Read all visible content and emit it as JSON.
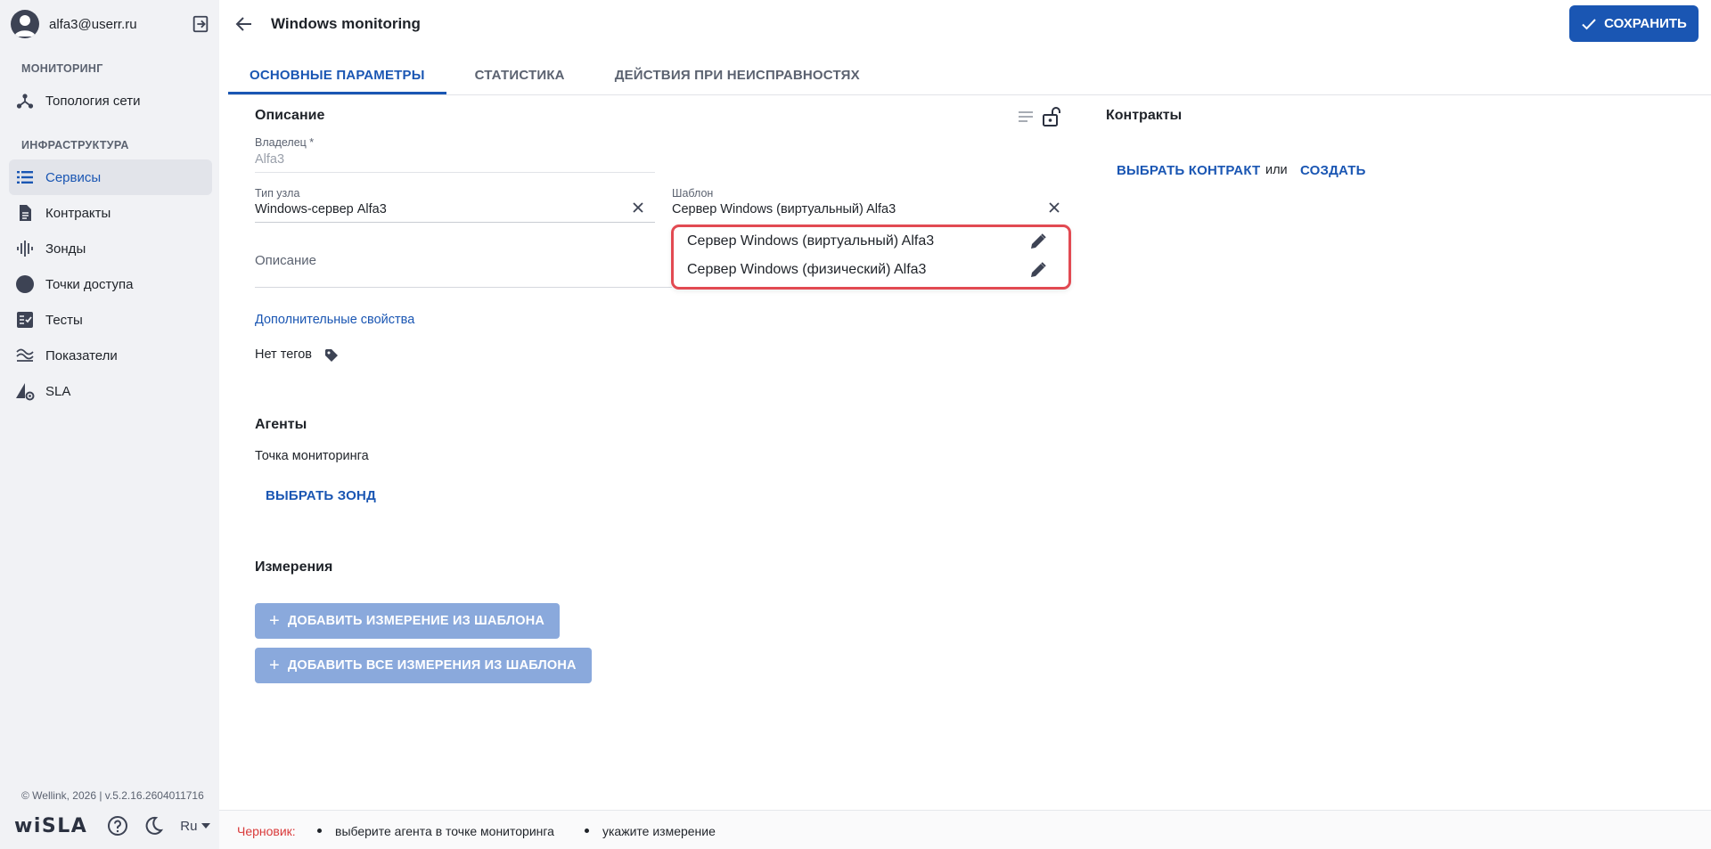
{
  "user": {
    "email": "alfa3@userr.ru"
  },
  "sidebar": {
    "sections": [
      {
        "title": "МОНИТОРИНГ"
      },
      {
        "title": "ИНФРАСТРУКТУРА"
      }
    ],
    "items": [
      {
        "label": "Топология сети",
        "icon": "topology-icon"
      },
      {
        "label": "Сервисы",
        "icon": "list-icon",
        "active": true
      },
      {
        "label": "Контракты",
        "icon": "document-icon"
      },
      {
        "label": "Зонды",
        "icon": "probe-icon"
      },
      {
        "label": "Точки доступа",
        "icon": "circle-icon"
      },
      {
        "label": "Тесты",
        "icon": "checklist-icon"
      },
      {
        "label": "Показатели",
        "icon": "waves-icon"
      },
      {
        "label": "SLA",
        "icon": "sla-settings-icon"
      }
    ],
    "copyright": "© Wellink, 2026 | v.5.2.16.2604011716",
    "logo": "wiSLA",
    "language": "Ru"
  },
  "header": {
    "title": "Windows monitoring",
    "save_label": "СОХРАНИТЬ"
  },
  "tabs": [
    {
      "label": "ОСНОВНЫЕ ПАРАМЕТРЫ",
      "active": true
    },
    {
      "label": "СТАТИСТИКА"
    },
    {
      "label": "ДЕЙСТВИЯ ПРИ НЕИСПРАВНОСТЯХ"
    }
  ],
  "description_section": {
    "title": "Описание",
    "owner_label": "Владелец *",
    "owner_value": "Alfa3",
    "node_type_label": "Тип узла",
    "node_type_value": "Windows-сервер Alfa3",
    "template_label": "Шаблон",
    "template_value": "Сервер Windows (виртуальный) Alfa3",
    "description_placeholder": "Описание",
    "extra_props_link": "Дополнительные свойства",
    "no_tags": "Нет тегов"
  },
  "template_dropdown": {
    "options": [
      "Сервер Windows (виртуальный) Alfa3",
      "Сервер Windows (физический) Alfa3"
    ]
  },
  "contracts": {
    "title": "Контракты",
    "select_label": "ВЫБРАТЬ КОНТРАКТ",
    "or_label": "или",
    "create_label": "СОЗДАТЬ"
  },
  "agents": {
    "title": "Агенты",
    "monitoring_point": "Точка мониторинга",
    "select_probe": "ВЫБРАТЬ ЗОНД"
  },
  "measurements": {
    "title": "Измерения",
    "add_from_template": "ДОБАВИТЬ ИЗМЕРЕНИЕ ИЗ ШАБЛОНА",
    "add_all_from_template": "ДОБАВИТЬ ВСЕ ИЗМЕРЕНИЯ ИЗ ШАБЛОНА"
  },
  "footer": {
    "draft_label": "Черновик:",
    "items": [
      "выберите агента в точке мониторинга",
      "укажите измерение"
    ]
  },
  "colors": {
    "accent": "#1a56b3",
    "sidebar_bg": "#f1f2f5",
    "highlight_border": "#e24a52",
    "draft_red": "#d93a3a",
    "disabled_button": "#8aa9dc"
  }
}
